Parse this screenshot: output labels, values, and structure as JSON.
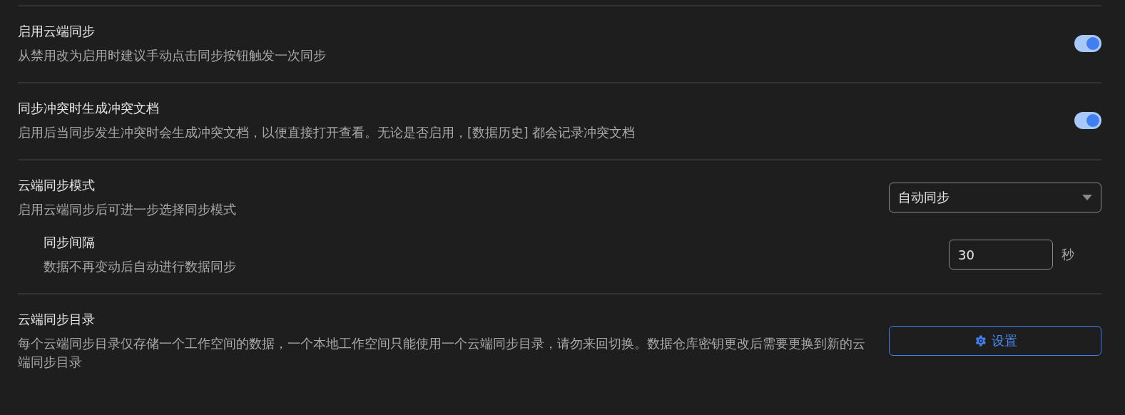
{
  "settings": [
    {
      "kind": "toggle",
      "title": "启用云端同步",
      "description": "从禁用改为启用时建议手动点击同步按钮触发一次同步",
      "on": true
    },
    {
      "kind": "toggle",
      "title": "同步冲突时生成冲突文档",
      "description": "启用后当同步发生冲突时会生成冲突文档，以便直接打开查看。无论是否启用，[数据历史] 都会记录冲突文档",
      "on": true
    },
    {
      "kind": "select",
      "title": "云端同步模式",
      "description": "启用云端同步后可进一步选择同步模式",
      "value": "自动同步",
      "children": [
        {
          "kind": "number",
          "title": "同步间隔",
          "description": "数据不再变动后自动进行数据同步",
          "value": "30",
          "unit": "秒"
        }
      ]
    },
    {
      "kind": "button",
      "title": "云端同步目录",
      "description": "每个云端同步目录仅存储一个工作空间的数据，一个本地工作空间只能使用一个云端同步目录，请勿来回切换。数据仓库密钥更改后需要更换到新的云端同步目录",
      "label": "设置"
    }
  ]
}
